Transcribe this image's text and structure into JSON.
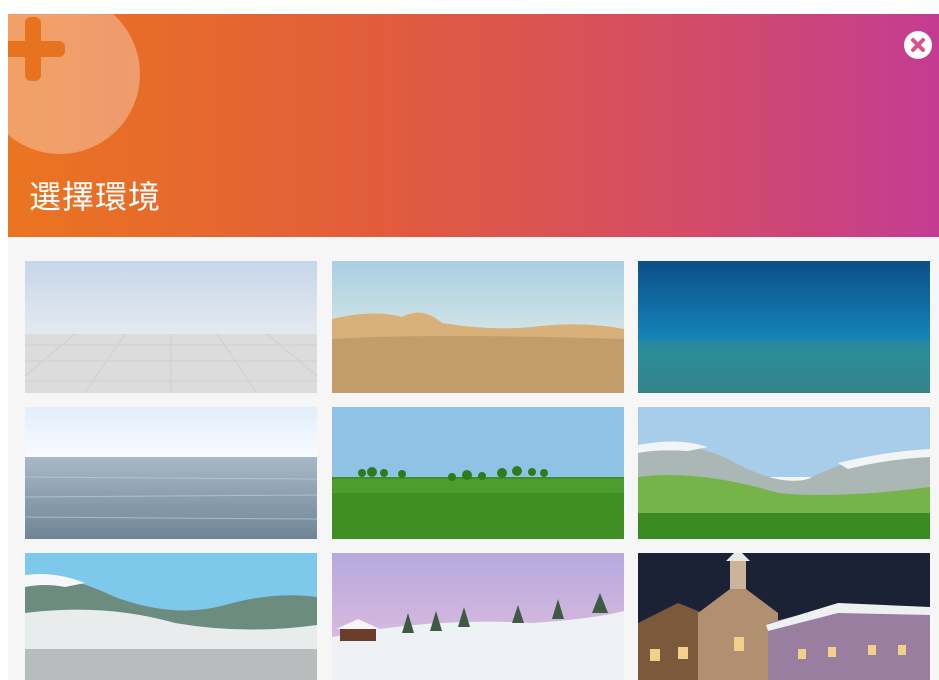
{
  "dialog": {
    "title": "選擇環境",
    "add_icon": "plus-icon",
    "close_icon": "close-circle-icon"
  },
  "environments": [
    {
      "name": "environment-blank-grid"
    },
    {
      "name": "environment-desert"
    },
    {
      "name": "environment-underwater"
    },
    {
      "name": "environment-ocean"
    },
    {
      "name": "environment-grass-field"
    },
    {
      "name": "environment-mountain-valley"
    },
    {
      "name": "environment-snowy-mountains"
    },
    {
      "name": "environment-winter-forest"
    },
    {
      "name": "environment-night-village"
    }
  ],
  "colors": {
    "header_gradient_start": "#ea7520",
    "header_gradient_end": "#c43c92",
    "background": "#f5f5f5"
  }
}
